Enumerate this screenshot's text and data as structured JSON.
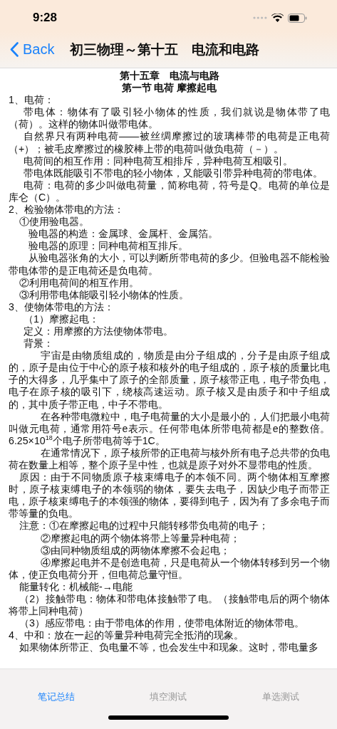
{
  "status_bar": {
    "time": "9:28"
  },
  "nav_bar": {
    "back": "Back",
    "title": "初三物理～第十五　电流和电路"
  },
  "document": {
    "paragraphs": [
      {
        "kind": "title",
        "text": "第十五章　电流与电路"
      },
      {
        "kind": "subtitle",
        "text": "第一节 电荷 摩擦起电"
      },
      {
        "kind": "section",
        "text": "1、电荷："
      },
      {
        "kind": "text",
        "text": "带电体：物体有了吸引轻小物体的性质，我们就说是物体带了电（荷）。这样的物体叫做带电体。"
      },
      {
        "kind": "text",
        "text": "自然界只有两种电荷——被丝绸摩擦过的玻璃棒带的电荷是正电荷（+）；被毛皮摩擦过的橡胶棒上带的电荷叫做负电荷（－）。"
      },
      {
        "kind": "text",
        "text": "电荷间的相互作用：同种电荷互相排斥，异种电荷互相吸引。"
      },
      {
        "kind": "text",
        "text": "带电体既能吸引不带电的轻小物体，又能吸引带异种电荷的带电体。"
      },
      {
        "kind": "text",
        "text": "电荷：电荷的多少叫做电荷量，简称电荷，符号是Q。电荷的单位是库仑（C）。"
      },
      {
        "kind": "section",
        "text": "2、检验物体带电的方法："
      },
      {
        "kind": "method",
        "text": "①使用验电器。"
      },
      {
        "kind": "point",
        "text": "验电器的构造：金属球、金属杆、金属箔。"
      },
      {
        "kind": "point",
        "text": "验电器的原理：同种电荷相互排斥。"
      },
      {
        "kind": "point",
        "text": "从验电器张角的大小，可以判断所带电荷的多少。但验电器不能检验带电体带的是正电荷还是负电荷。"
      },
      {
        "kind": "method",
        "text": "②利用电荷间的相互作用。"
      },
      {
        "kind": "method",
        "text": "③利用带电体能吸引轻小物体的性质。"
      },
      {
        "kind": "section",
        "text": "3、使物体带电的方法："
      },
      {
        "kind": "text",
        "text": "（1）摩擦起电："
      },
      {
        "kind": "text",
        "text": "定义：用摩擦的方法使物体带电。"
      },
      {
        "kind": "text",
        "text": "背景："
      },
      {
        "kind": "story",
        "text": "宇宙是由物质组成的，物质是由分子组成的，分子是由原子组成的，原子是由位于中心的原子核和核外的电子组成的，原子核的质量比电子的大得多，几乎集中了原子的全部质量，原子核带正电，电子带负电，电子在原子核的吸引下，绕核高速运动。原子核又是由质子和中子组成的，其中质子带正电，中子不带电。"
      },
      {
        "kind": "story",
        "text": "在各种带电微粒中，电子电荷量的大小是最小的，人们把最小电荷叫做元电荷，通常用符号e表示。任何带电体所带电荷都是e的整数倍。6.25×10$^{18}$个电子所带电荷等于1C。"
      },
      {
        "kind": "story",
        "text": "在通常情况下，原子核所带的正电荷与核外所有电子总共带的负电荷在数量上相等，整个原子呈中性，也就是原子对外不显带电的性质。"
      },
      {
        "kind": "method",
        "text": "原因：由于不同物质原子核束缚电子的本领不同。两个物体相互摩擦时，原子核束缚电子的本领弱的物体，要失去电子，因缺少电子而带正电，原子核束缚电子的本领强的物体，要得到电子，因为有了多余电子而带等量的负电。"
      },
      {
        "kind": "method",
        "text": "注意：①在摩擦起电的过程中只能转移带负电荷的电子；"
      },
      {
        "kind": "story",
        "text": "②摩擦起电的两个物体将带上等量异种电荷；"
      },
      {
        "kind": "story",
        "text": "③由同种物质组成的两物体摩擦不会起电；"
      },
      {
        "kind": "story",
        "text": "④摩擦起电并不是创造电荷，只是电荷从一个物体转移到另一个物体，使正负电荷分开，但电荷总量守恒。"
      },
      {
        "kind": "method",
        "text": "能量转化：机械能-→电能"
      },
      {
        "kind": "method",
        "text": "（2）接触带电：物体和带电体接触带了电。（接触带电后的两个物体将带上同种电荷）"
      },
      {
        "kind": "method",
        "text": "（3）感应带电：由于带电体的作用，使带电体附近的物体带电。"
      },
      {
        "kind": "section",
        "text": "4、中和：放在一起的等量异种电荷完全抵消的现象。"
      },
      {
        "kind": "method",
        "text": "如果物体所带正、负电量不等，也会发生中和现象。这时，带电量多"
      }
    ]
  },
  "tab_bar": {
    "tabs": [
      {
        "label": "笔记总结",
        "selected": true
      },
      {
        "label": "填空测试",
        "selected": false
      },
      {
        "label": "单选测试",
        "selected": false
      }
    ]
  }
}
